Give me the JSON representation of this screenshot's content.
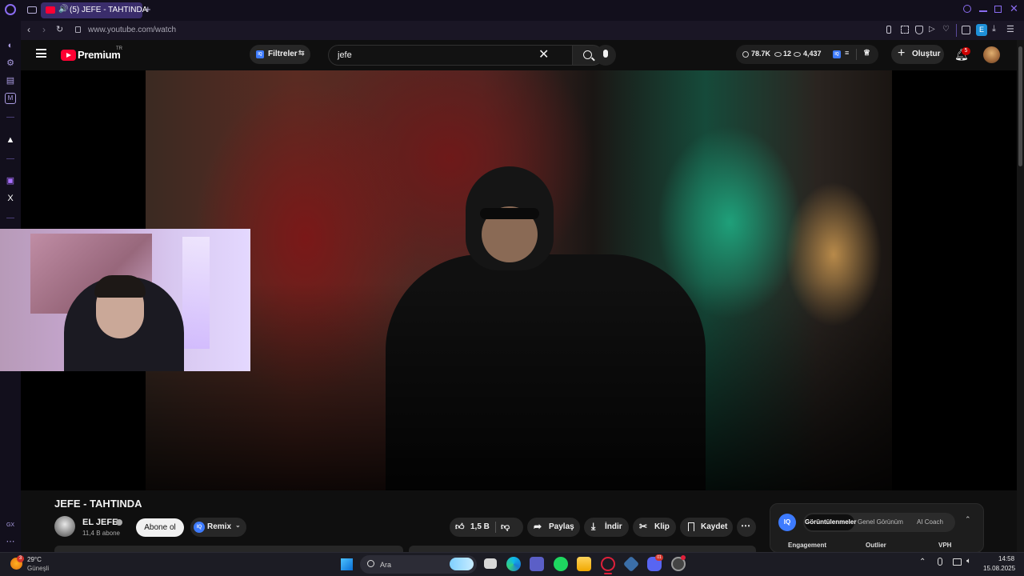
{
  "browser": {
    "tab_title": "(5) JEFE - TAHTINDA",
    "url": "www.youtube.com/watch",
    "extension_badge": "E"
  },
  "youtube": {
    "logo_text": "Premium",
    "country_code": "TR",
    "filters_label": "Filtreler",
    "search_value": "jefe",
    "stats": {
      "a": "78.7K",
      "b": "12",
      "c": "4,437"
    },
    "create_label": "Oluştur",
    "notification_count": "5"
  },
  "video": {
    "title": "JEFE - TAHTINDA",
    "channel_name": "EL JEFE",
    "subscribers": "11,4 B abone",
    "subscribe_label": "Abone ol",
    "remix_label": "Remix",
    "like_count": "1,5 B",
    "share_label": "Paylaş",
    "download_label": "İndir",
    "clip_label": "Klip",
    "save_label": "Kaydet"
  },
  "iq_panel": {
    "logo": "IQ",
    "tabs": [
      "Görüntülenmeler",
      "Genel Görünüm",
      "AI Coach"
    ],
    "columns": [
      "Engagement",
      "Outlier",
      "VPH"
    ]
  },
  "taskbar": {
    "weather_temp": "29°C",
    "weather_desc": "Güneşli",
    "weather_badge": "3",
    "search_placeholder": "Ara",
    "time": "14:58",
    "date": "15.08.2025",
    "discord_badge": "01"
  },
  "sidebar": {
    "bottom_label": "GX"
  },
  "colors": {
    "youtube_red": "#ff0033",
    "opera_purple": "#6c4fd8",
    "iq_blue": "#3d7bff"
  }
}
